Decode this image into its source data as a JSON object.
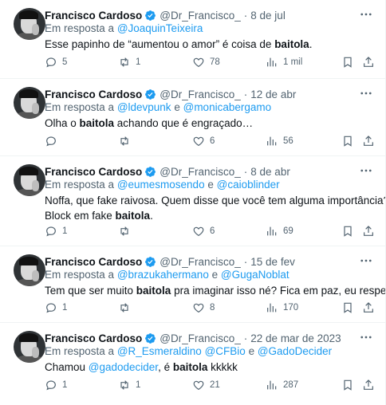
{
  "colors": {
    "accent": "#1d9bf0",
    "muted": "#536471",
    "text": "#0f1419",
    "border": "#eff3f4"
  },
  "tweets": [
    {
      "name": "Francisco Cardoso",
      "handle": "@Dr_Francisco_",
      "date": "8 de jul",
      "reply_prefix": "Em resposta a",
      "reply_to": [
        "@JoaquinTeixeira"
      ],
      "text_before": "Esse papinho de “aumentou o amor” é coisa de ",
      "text_bold": "baitola",
      "text_after": ".",
      "replies": "5",
      "retweets": "1",
      "likes": "78",
      "views": "1 mil"
    },
    {
      "name": "Francisco Cardoso",
      "handle": "@Dr_Francisco_",
      "date": "12 de abr",
      "reply_prefix": "Em resposta a",
      "reply_to": [
        "@ldevpunk",
        "@monicabergamo"
      ],
      "reply_joiner": "e",
      "text_before": "Olha o ",
      "text_bold": "baitola",
      "text_after": " achando que é engraçado…",
      "replies": "",
      "retweets": "",
      "likes": "6",
      "views": "56"
    },
    {
      "name": "Francisco Cardoso",
      "handle": "@Dr_Francisco_",
      "date": "8 de abr",
      "reply_prefix": "Em resposta a",
      "reply_to": [
        "@eumesmosendo",
        "@caioblinder"
      ],
      "reply_joiner": "e",
      "text_line1": "Noffa, que fake raivosa. Quem disse que você tem alguma importância?",
      "text_before": "Block em fake ",
      "text_bold": "baitola",
      "text_after": ".",
      "replies": "1",
      "retweets": "",
      "likes": "6",
      "views": "69"
    },
    {
      "name": "Francisco Cardoso",
      "handle": "@Dr_Francisco_",
      "date": "15 de fev",
      "reply_prefix": "Em resposta a",
      "reply_to": [
        "@brazukahermano",
        "@GugaNoblat"
      ],
      "reply_joiner": "e",
      "text_before": "Tem que ser muito ",
      "text_bold": "baitola",
      "text_after": " pra imaginar isso né? Fica em paz, eu respeito.",
      "replies": "1",
      "retweets": "",
      "likes": "8",
      "views": "170"
    },
    {
      "name": "Francisco Cardoso",
      "handle": "@Dr_Francisco_",
      "date": "22 de mar de 2023",
      "reply_prefix": "Em resposta a",
      "reply_to": [
        "@R_Esmeraldino",
        "@CFBio",
        "@GadoDecider"
      ],
      "reply_joiner": "e",
      "text_mention": "@gadodecider",
      "text_before": "Chamou ",
      "text_mid": ", é ",
      "text_bold": "baitola",
      "text_after": " kkkkk",
      "replies": "1",
      "retweets": "1",
      "likes": "21",
      "views": "287"
    }
  ]
}
